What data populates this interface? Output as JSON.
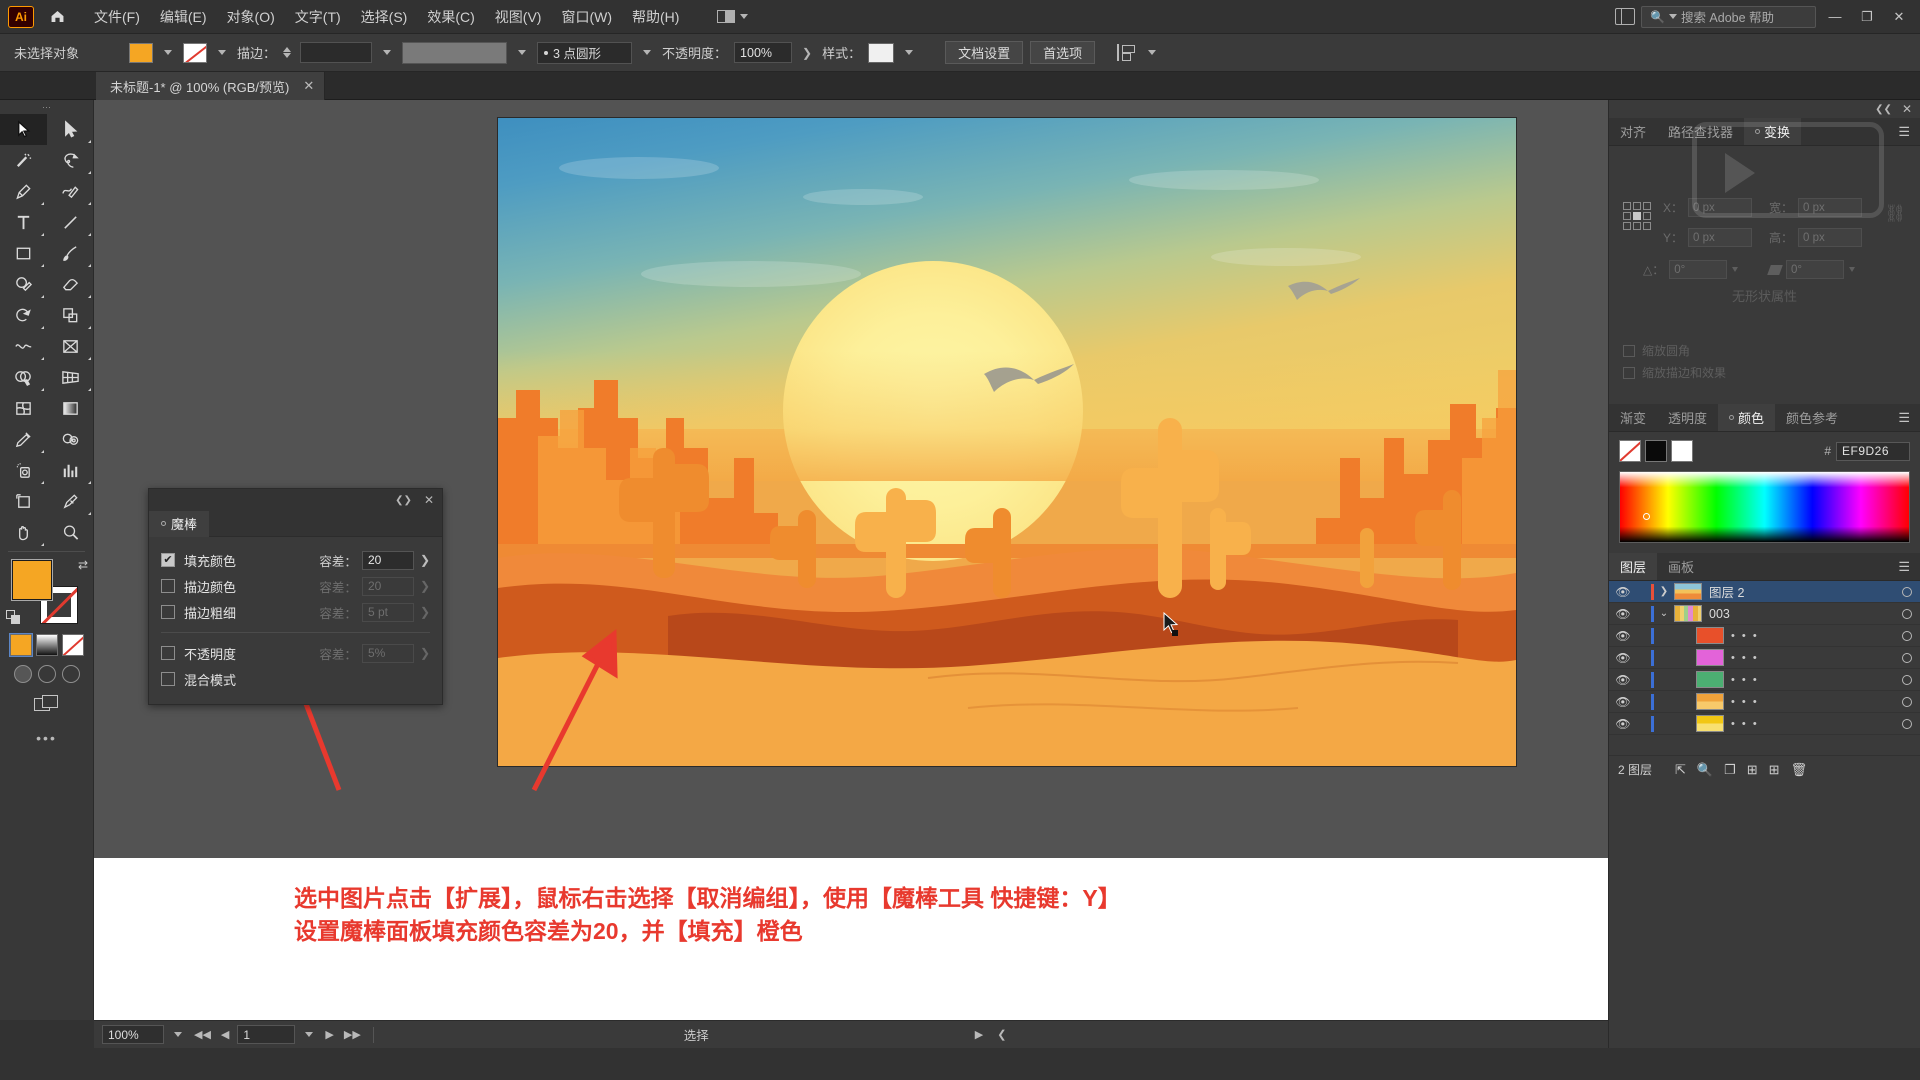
{
  "app": {
    "logo": "Ai",
    "home_icon": "home-icon"
  },
  "menubar": {
    "items": [
      {
        "label": "文件(F)"
      },
      {
        "label": "编辑(E)"
      },
      {
        "label": "对象(O)"
      },
      {
        "label": "文字(T)"
      },
      {
        "label": "选择(S)"
      },
      {
        "label": "效果(C)"
      },
      {
        "label": "视图(V)"
      },
      {
        "label": "窗口(W)"
      },
      {
        "label": "帮助(H)"
      }
    ],
    "search_placeholder": "搜索 Adobe 帮助",
    "window_buttons": {
      "minimize": "—",
      "restore": "❐",
      "close": "✕"
    }
  },
  "controlbar": {
    "selection_status": "未选择对象",
    "stroke_label": "描边：",
    "stroke_value": "",
    "profile_value": "3 点圆形",
    "opacity_label": "不透明度：",
    "opacity_value": "100%",
    "style_label": "样式：",
    "doc_setup_button": "文档设置",
    "preferences_button": "首选项",
    "fill_color": "#F5A623"
  },
  "tabbar": {
    "document_tab": "未标题-1* @ 100% (RGB/预览)",
    "close_label": "✕"
  },
  "toolbar": {
    "tools": [
      {
        "name": "selection-tool",
        "selected": true
      },
      {
        "name": "direct-selection-tool",
        "selected": false
      },
      {
        "name": "magic-wand-tool",
        "selected": false
      },
      {
        "name": "lasso-tool",
        "selected": false
      },
      {
        "name": "pen-tool",
        "selected": false
      },
      {
        "name": "curvature-tool",
        "selected": false
      },
      {
        "name": "type-tool",
        "selected": false
      },
      {
        "name": "line-segment-tool",
        "selected": false
      },
      {
        "name": "rectangle-tool",
        "selected": false
      },
      {
        "name": "paintbrush-tool",
        "selected": false
      },
      {
        "name": "shaper-tool",
        "selected": false
      },
      {
        "name": "eraser-tool",
        "selected": false
      },
      {
        "name": "rotate-tool",
        "selected": false
      },
      {
        "name": "scale-tool",
        "selected": false
      },
      {
        "name": "width-tool",
        "selected": false
      },
      {
        "name": "free-transform-tool",
        "selected": false
      },
      {
        "name": "shape-builder-tool",
        "selected": false
      },
      {
        "name": "perspective-grid-tool",
        "selected": false
      },
      {
        "name": "mesh-tool",
        "selected": false
      },
      {
        "name": "gradient-tool",
        "selected": false
      },
      {
        "name": "eyedropper-tool",
        "selected": false
      },
      {
        "name": "blend-tool",
        "selected": false
      },
      {
        "name": "symbol-sprayer-tool",
        "selected": false
      },
      {
        "name": "column-graph-tool",
        "selected": false
      },
      {
        "name": "artboard-tool",
        "selected": false
      },
      {
        "name": "slice-tool",
        "selected": false
      },
      {
        "name": "hand-tool",
        "selected": false
      },
      {
        "name": "zoom-tool",
        "selected": false
      }
    ],
    "fill_color": "#F5A623",
    "stroke_color": "none",
    "more_tools": "•••"
  },
  "magic_wand_panel": {
    "title": "魔棒",
    "close_label": "✕",
    "collapse_label": "❮❯",
    "rows": [
      {
        "label": "填充颜色",
        "checked": true,
        "tolerance_label": "容差：",
        "tolerance_value": "20",
        "enabled": true
      },
      {
        "label": "描边颜色",
        "checked": false,
        "tolerance_label": "容差：",
        "tolerance_value": "20",
        "enabled": false
      },
      {
        "label": "描边粗细",
        "checked": false,
        "tolerance_label": "容差：",
        "tolerance_value": "5 pt",
        "enabled": false
      },
      {
        "label": "不透明度",
        "checked": false,
        "tolerance_label": "容差：",
        "tolerance_value": "5%",
        "enabled": false
      },
      {
        "label": "混合模式",
        "checked": false,
        "tolerance_label": "",
        "tolerance_value": "",
        "enabled": false
      }
    ]
  },
  "transform_panel": {
    "tabs": [
      {
        "label": "对齐",
        "active": false
      },
      {
        "label": "路径查找器",
        "active": false
      },
      {
        "label": "变换",
        "active": true
      }
    ],
    "fields": {
      "x_label": "X：",
      "x_value": "0 px",
      "y_label": "Y：",
      "y_value": "0 px",
      "w_label": "宽：",
      "w_value": "0 px",
      "h_label": "高：",
      "h_value": "0 px",
      "angle_label": "△：",
      "angle_value": "0°",
      "shear_label": "",
      "shear_value": "0°"
    },
    "empty_text": "无形状属性",
    "checkboxes": [
      {
        "label": "缩放圆角"
      },
      {
        "label": "缩放描边和效果"
      }
    ],
    "menu_icon": "hamburger-icon"
  },
  "color_panel": {
    "tabs": [
      {
        "label": "渐变",
        "active": false
      },
      {
        "label": "透明度",
        "active": false
      },
      {
        "label": "颜色",
        "active": true
      },
      {
        "label": "颜色参考",
        "active": false
      }
    ],
    "hex_prefix": "#",
    "hex_value": "EF9D26",
    "swatches": [
      "none",
      "#0A0A0A",
      "#FFFFFF"
    ],
    "menu_icon": "hamburger-icon"
  },
  "layers_panel": {
    "tabs": [
      {
        "label": "图层",
        "active": true
      },
      {
        "label": "画板",
        "active": false
      }
    ],
    "menu_icon": "hamburger-icon",
    "rows": [
      {
        "name": "图层 2",
        "selected": true,
        "expanded": false,
        "has_thumb": true,
        "thumb": "image",
        "indent": 0,
        "bar_color": "#e8503a",
        "eye_icon": "eye-icon",
        "dots": ""
      },
      {
        "name": "003",
        "selected": false,
        "expanded": true,
        "has_thumb": true,
        "thumb": "group",
        "indent": 1,
        "bar_color": "#3b6fd6",
        "eye_icon": "eye-icon",
        "dots": ""
      },
      {
        "name": "",
        "selected": false,
        "expanded": false,
        "has_thumb": true,
        "thumb": "#e8502a",
        "indent": 2,
        "bar_color": "#3b6fd6",
        "eye_icon": "eye-icon",
        "dots": "• • •"
      },
      {
        "name": "",
        "selected": false,
        "expanded": false,
        "has_thumb": true,
        "thumb": "#e363d9",
        "indent": 2,
        "bar_color": "#3b6fd6",
        "eye_icon": "eye-icon",
        "dots": "• • •"
      },
      {
        "name": "",
        "selected": false,
        "expanded": false,
        "has_thumb": true,
        "thumb": "#4caf72",
        "indent": 2,
        "bar_color": "#3b6fd6",
        "eye_icon": "eye-icon",
        "dots": "• • •"
      },
      {
        "name": "",
        "selected": false,
        "expanded": false,
        "has_thumb": true,
        "thumb": "#f0a23a",
        "indent": 2,
        "bar_color": "#3b6fd6",
        "eye_icon": "eye-icon",
        "dots": "• • •"
      },
      {
        "name": "",
        "selected": false,
        "expanded": false,
        "has_thumb": true,
        "thumb": "#f2c713",
        "indent": 2,
        "bar_color": "#3b6fd6",
        "eye_icon": "eye-icon",
        "dots": "• • •"
      }
    ],
    "footer": {
      "count_text": "2 图层",
      "icons": [
        "locate-object-icon",
        "search-icon",
        "new-sublayer-icon",
        "make-clipping-mask-icon",
        "new-layer-icon",
        "delete-layer-icon"
      ]
    }
  },
  "statusbar": {
    "zoom_value": "100%",
    "page_value": "1",
    "status_text": "选择",
    "nav_first": "◀◀",
    "nav_prev": "◀",
    "nav_next": "▶",
    "nav_last": "▶▶"
  },
  "annotation": {
    "line1": "选中图片点击【扩展】，鼠标右击选择【取消编组】，使用【魔棒工具 快捷键：Y】",
    "line2": "设置魔棒面板填充颜色容差为20，并【填充】橙色",
    "color": "#E8392E"
  },
  "canvas": {
    "artboard_description": "desert-sunset-illustration",
    "cursor": "cursor-arrow"
  }
}
